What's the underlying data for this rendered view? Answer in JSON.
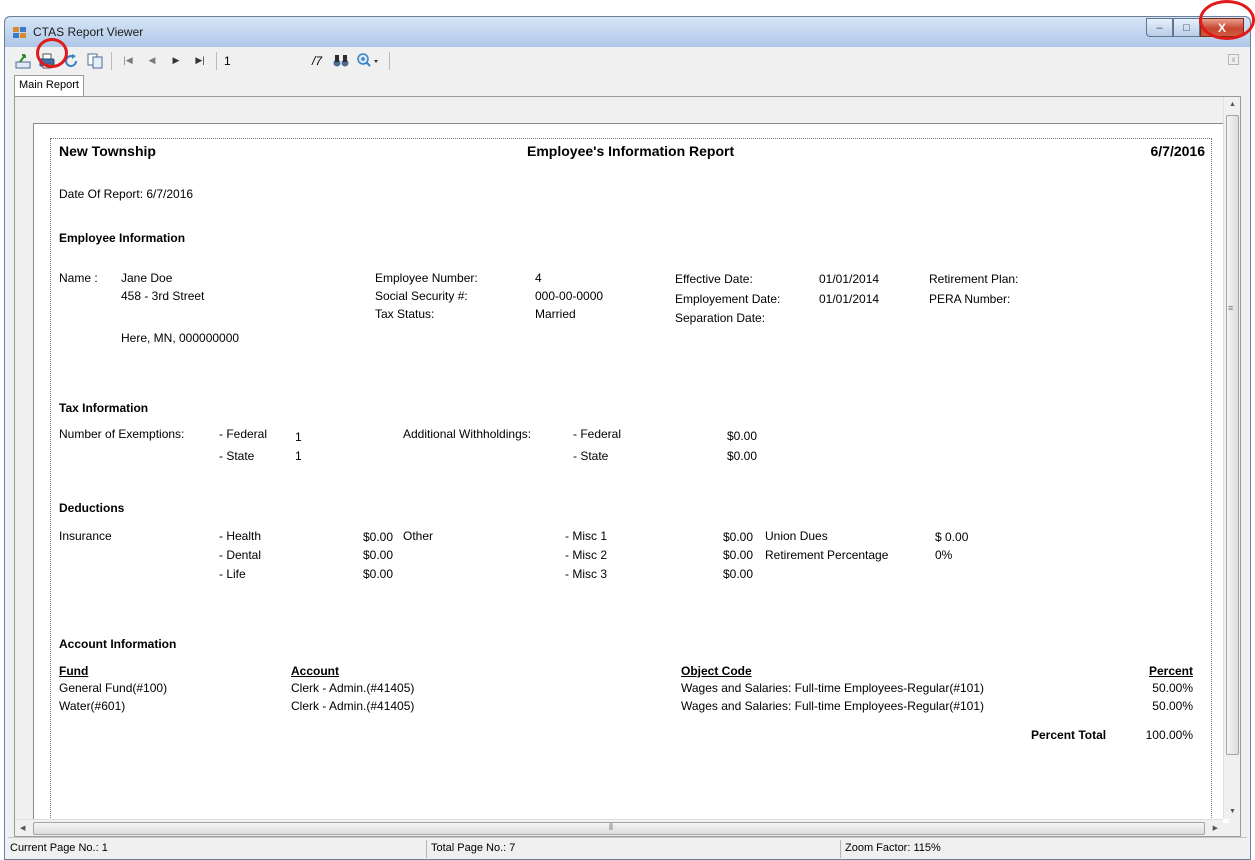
{
  "window": {
    "title": "CTAS Report Viewer",
    "minimize_glyph": "–",
    "maximize_glyph": "□",
    "close_glyph": "X"
  },
  "toolbar": {
    "page_number": "1",
    "total_pages": "/7",
    "icons": [
      "export-icon",
      "print-icon",
      "refresh-icon",
      "copy-icon",
      "first-page-icon",
      "previous-page-icon",
      "next-page-icon",
      "last-page-icon",
      "find-icon",
      "zoom-icon"
    ]
  },
  "tabs": [
    {
      "label": "Main Report"
    }
  ],
  "report": {
    "org_name": "New Township",
    "title": "Employee's Information Report",
    "print_date": "6/7/2016",
    "date_of_report": "Date Of Report: 6/7/2016",
    "employee_section": {
      "heading": "Employee Information",
      "name_label": "Name :",
      "name": "Jane Doe",
      "address1": "458 - 3rd Street",
      "address2": "Here, MN, 000000000",
      "emp_number_label": "Employee Number:",
      "emp_number": "4",
      "ssn_label": "Social Security #:",
      "ssn": "000-00-0000",
      "tax_status_label": "Tax Status:",
      "tax_status": "Married",
      "effective_date_label": "Effective Date:",
      "effective_date": "01/01/2014",
      "employment_date_label": "Employement Date:",
      "employment_date": "01/01/2014",
      "separation_date_label": "Separation Date:",
      "retirement_plan_label": "Retirement Plan:",
      "pera_number_label": "PERA Number:"
    },
    "tax_section": {
      "heading": "Tax Information",
      "exemptions_label": "Number of Exemptions:",
      "federal_label": "- Federal",
      "federal_exemptions": "1",
      "state_label": "- State",
      "state_exemptions": "1",
      "withholdings_label": "Additional Withholdings:",
      "federal_withholding": "$0.00",
      "state_withholding": "$0.00"
    },
    "deductions_section": {
      "heading": "Deductions",
      "insurance_label": "Insurance",
      "health_label": "- Health",
      "health": "$0.00",
      "dental_label": "- Dental",
      "dental": "$0.00",
      "life_label": "- Life",
      "life": "$0.00",
      "other_label": "Other",
      "misc1_label": "- Misc 1",
      "misc1": "$0.00",
      "misc2_label": "- Misc 2",
      "misc2": "$0.00",
      "misc3_label": "- Misc 3",
      "misc3": "$0.00",
      "union_dues_label": "Union Dues",
      "union_dues": "$ 0.00",
      "retirement_pct_label": "Retirement Percentage",
      "retirement_pct": "0%"
    },
    "account_section": {
      "heading": "Account Information",
      "columns": {
        "fund": "Fund",
        "account": "Account",
        "object_code": "Object Code",
        "percent": "Percent"
      },
      "rows": [
        {
          "fund": "General Fund(#100)",
          "account": "Clerk - Admin.(#41405)",
          "object_code": "Wages and Salaries: Full-time Employees-Regular(#101)",
          "percent": "50.00%"
        },
        {
          "fund": "Water(#601)",
          "account": "Clerk - Admin.(#41405)",
          "object_code": "Wages and Salaries: Full-time Employees-Regular(#101)",
          "percent": "50.00%"
        }
      ],
      "percent_total_label": "Percent Total",
      "percent_total": "100.00%"
    }
  },
  "statusbar": {
    "current_page": "Current Page No.: 1",
    "total_pages": "Total Page No.: 7",
    "zoom_factor": "Zoom Factor: 115%"
  },
  "colors": {
    "annotation_red": "#e01919",
    "title_bar": "#aec7e8"
  }
}
